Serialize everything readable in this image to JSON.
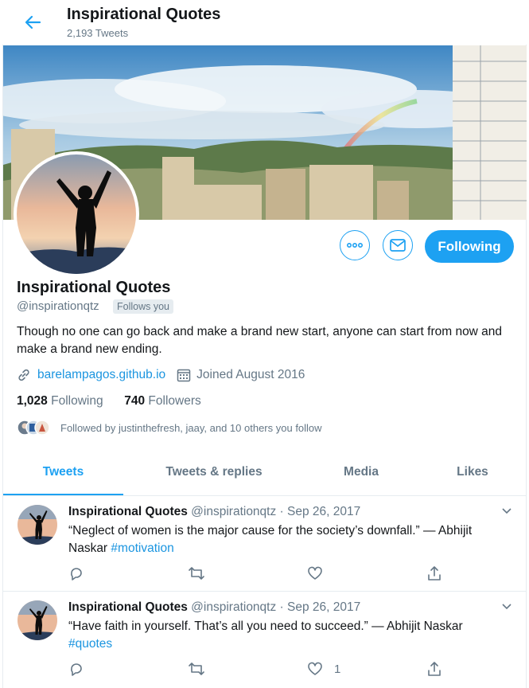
{
  "header": {
    "title": "Inspirational Quotes",
    "tweet_count": "2,193 Tweets"
  },
  "profile": {
    "name": "Inspirational Quotes",
    "handle": "@inspirationqtz",
    "follows_you": "Follows you",
    "bio": "Though no one can go back and make a brand new start, anyone can start from now and make a brand new ending.",
    "website": "barelampagos.github.io",
    "joined": "Joined August 2016",
    "following_count": "1,028",
    "following_label": "Following",
    "followers_count": "740",
    "followers_label": "Followers",
    "followed_by": "Followed by justinthefresh, jaay, and 10 others you follow",
    "follow_button": "Following"
  },
  "tabs": [
    {
      "label": "Tweets",
      "active": true
    },
    {
      "label": "Tweets & replies"
    },
    {
      "label": "Media"
    },
    {
      "label": "Likes"
    }
  ],
  "tweets": [
    {
      "name": "Inspirational Quotes",
      "handle": "@inspirationqtz",
      "date": "Sep 26, 2017",
      "text": "“Neglect of women is the major cause for the society’s downfall.” — Abhijit Naskar",
      "hashtag": "#motivation",
      "likes": ""
    },
    {
      "name": "Inspirational Quotes",
      "handle": "@inspirationqtz",
      "date": "Sep 26, 2017",
      "text": "“Have faith in yourself. That’s all you need to succeed.” — Abhijit Naskar",
      "hashtag": "#quotes",
      "likes": "1"
    }
  ],
  "colors": {
    "accent": "#1da1f2",
    "link": "#1b95e0",
    "muted": "#657786",
    "border": "#e6ecf0"
  }
}
